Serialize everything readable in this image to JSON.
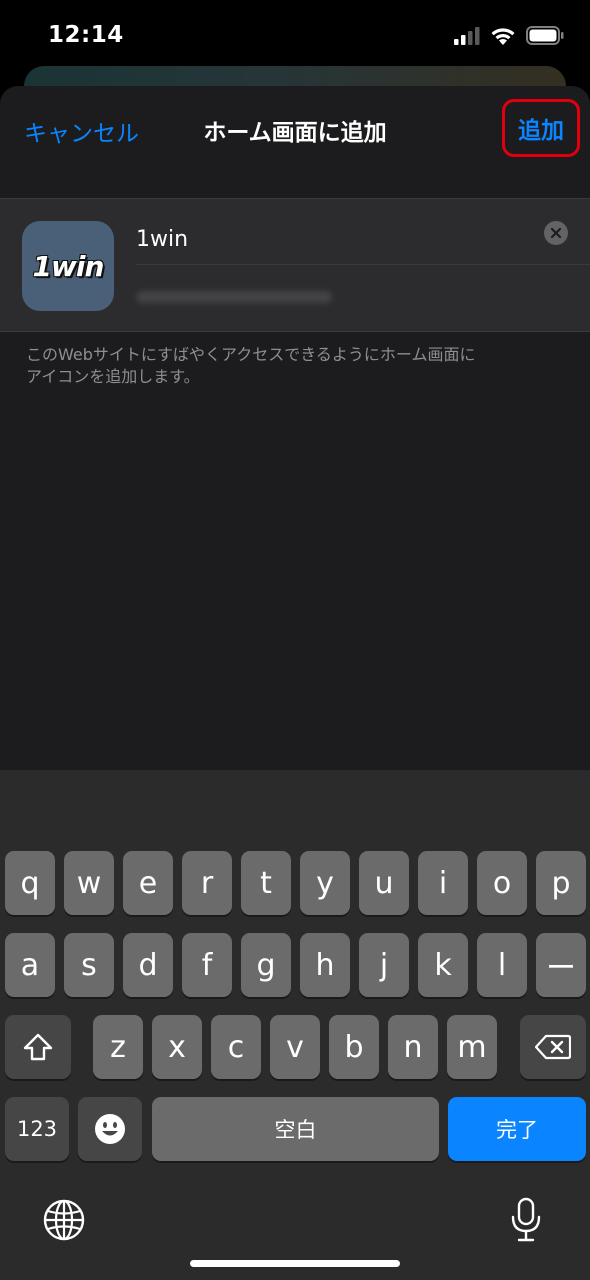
{
  "status_bar": {
    "time": "12:14"
  },
  "nav": {
    "cancel_label": "キャンセル",
    "title": "ホーム画面に追加",
    "add_label": "追加"
  },
  "app": {
    "icon_text": "1win",
    "name_value": "1win"
  },
  "description": "このWebサイトにすばやくアクセスできるようにホーム画面に\nアイコンを追加します。",
  "keyboard": {
    "row1": [
      "q",
      "w",
      "e",
      "r",
      "t",
      "y",
      "u",
      "i",
      "o",
      "p"
    ],
    "row2": [
      "a",
      "s",
      "d",
      "f",
      "g",
      "h",
      "j",
      "k",
      "l",
      "ー"
    ],
    "row3": [
      "z",
      "x",
      "c",
      "v",
      "b",
      "n",
      "m"
    ],
    "numbers_label": "123",
    "space_label": "空白",
    "done_label": "完了"
  },
  "colors": {
    "accent": "#0a84ff",
    "highlight_border": "#e0000e",
    "sheet_bg": "#1c1c1e"
  },
  "icons": [
    "cellular-signal-icon",
    "wifi-icon",
    "battery-icon",
    "clear-icon",
    "shift-icon",
    "delete-icon",
    "emoji-icon",
    "globe-icon",
    "microphone-icon"
  ]
}
